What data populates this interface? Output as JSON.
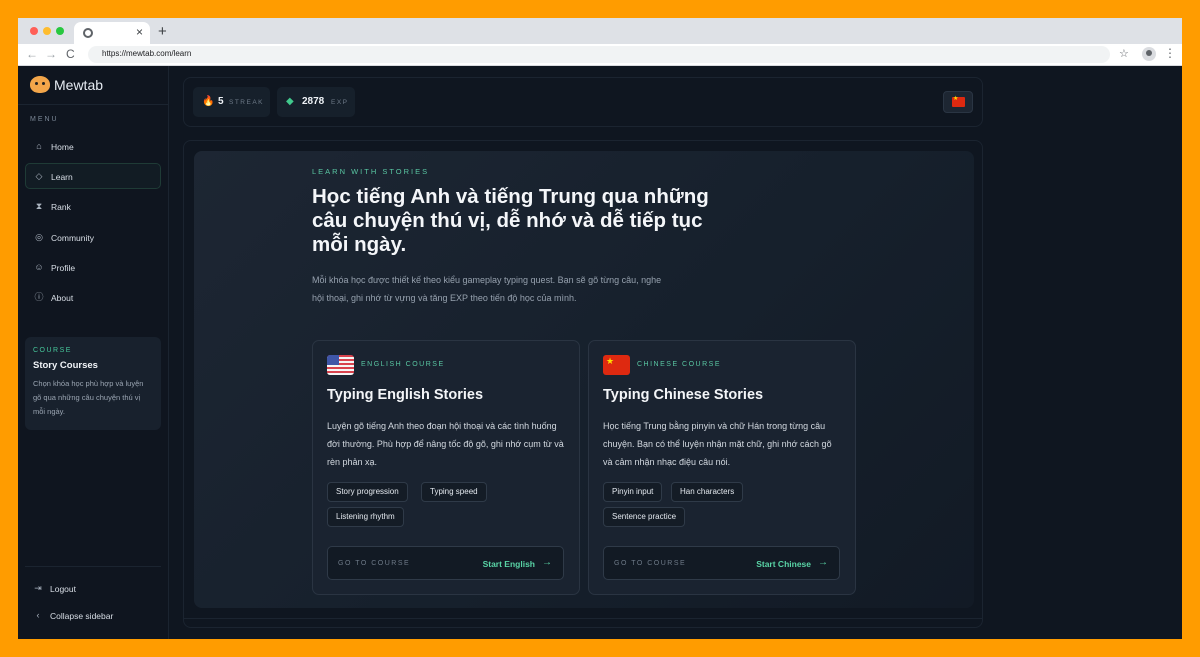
{
  "browser": {
    "tab_close": "×",
    "new_tab": "+",
    "url": "https://mewtab.com/learn",
    "back": "←",
    "forward": "→",
    "reload": "C",
    "star": "☆",
    "menu": "⋮"
  },
  "brand": {
    "name": "Mewtab"
  },
  "sidebar": {
    "menu_label": "MENU",
    "items": [
      {
        "label": "Home",
        "icon": "⌂"
      },
      {
        "label": "Learn",
        "icon": "◇"
      },
      {
        "label": "Rank",
        "icon": "⧗"
      },
      {
        "label": "Community",
        "icon": "◎"
      },
      {
        "label": "Profile",
        "icon": "☺"
      },
      {
        "label": "About",
        "icon": "ⓘ"
      }
    ],
    "course_card": {
      "kicker": "COURSE",
      "title": "Story Courses",
      "description": "Chọn khóa học phù hợp và luyện gõ qua những câu chuyện thú vị mỗi ngày."
    },
    "logout": {
      "label": "Logout",
      "icon": "⇥"
    },
    "collapse": {
      "label": "Collapse sidebar",
      "icon": "‹"
    }
  },
  "stats": {
    "streak": {
      "value": "5",
      "label": "STREAK",
      "icon": "🔥"
    },
    "exp": {
      "value": "2878",
      "label": "EXP",
      "icon": "◆"
    }
  },
  "hero": {
    "eyebrow": "LEARN WITH STORIES",
    "headline": "Học tiếng Anh và tiếng Trung qua những câu chuyện thú vị, dễ nhớ và dễ tiếp tục mỗi ngày.",
    "lede": "Mỗi khóa học được thiết kế theo kiểu gameplay typing quest. Bạn sẽ gõ từng câu, nghe hội thoại, ghi nhớ từ vựng và tăng EXP theo tiến độ học của mình."
  },
  "courses": {
    "english": {
      "tag": "ENGLISH COURSE",
      "title": "Typing English Stories",
      "description": "Luyện gõ tiếng Anh theo đoạn hội thoại và các tình huống đời thường. Phù hợp để nâng tốc độ gõ, ghi nhớ cụm từ và rèn phản xạ.",
      "chips": [
        "Story progression",
        "Typing speed",
        "Listening rhythm"
      ],
      "goto_label": "GO TO COURSE",
      "start_label": "Start English",
      "arrow": "→"
    },
    "chinese": {
      "tag": "CHINESE COURSE",
      "title": "Typing Chinese Stories",
      "description": "Học tiếng Trung bằng pinyin và chữ Hán trong từng câu chuyện. Bạn có thể luyện nhận mặt chữ, ghi nhớ cách gõ và cảm nhận nhạc điệu câu nói.",
      "chips": [
        "Pinyin input",
        "Han characters",
        "Sentence practice"
      ],
      "goto_label": "GO TO COURSE",
      "start_label": "Start Chinese",
      "arrow": "→"
    }
  }
}
